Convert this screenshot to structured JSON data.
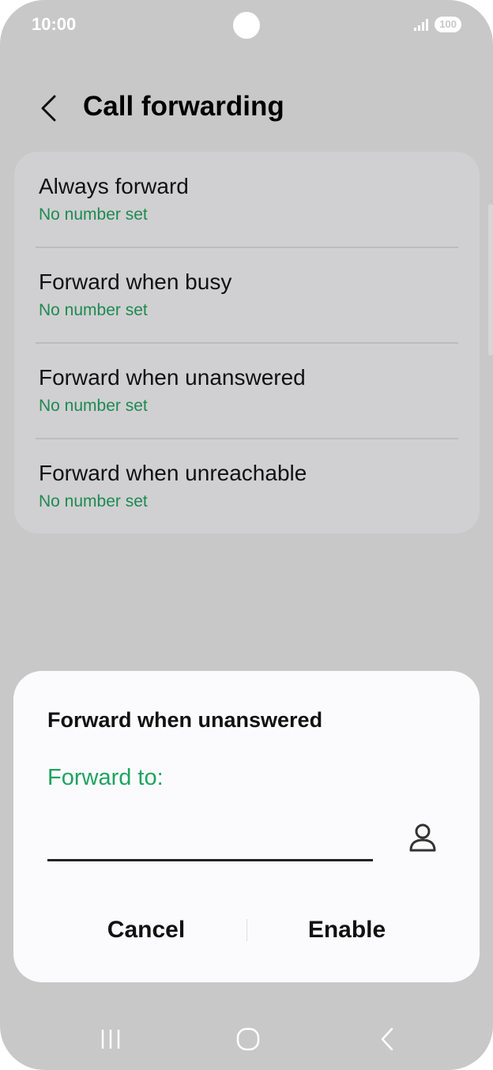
{
  "status_bar": {
    "time": "10:00",
    "battery": "100"
  },
  "header": {
    "title": "Call forwarding",
    "back_icon": "chevron-left-icon"
  },
  "list": {
    "items": [
      {
        "title": "Always forward",
        "subtitle": "No number set"
      },
      {
        "title": "Forward when busy",
        "subtitle": "No number set"
      },
      {
        "title": "Forward when unanswered",
        "subtitle": "No number set"
      },
      {
        "title": "Forward when unreachable",
        "subtitle": "No number set"
      }
    ]
  },
  "dialog": {
    "title": "Forward when unanswered",
    "label": "Forward to:",
    "input_value": "",
    "contact_icon": "person-icon",
    "cancel_label": "Cancel",
    "enable_label": "Enable"
  },
  "nav_bar": {
    "recents_icon": "recents-icon",
    "home_icon": "home-icon",
    "back_icon": "back-icon"
  },
  "colors": {
    "accent_green": "#1fa35f",
    "subtitle_green": "#1e8a50",
    "background": "#c8c8c8"
  }
}
